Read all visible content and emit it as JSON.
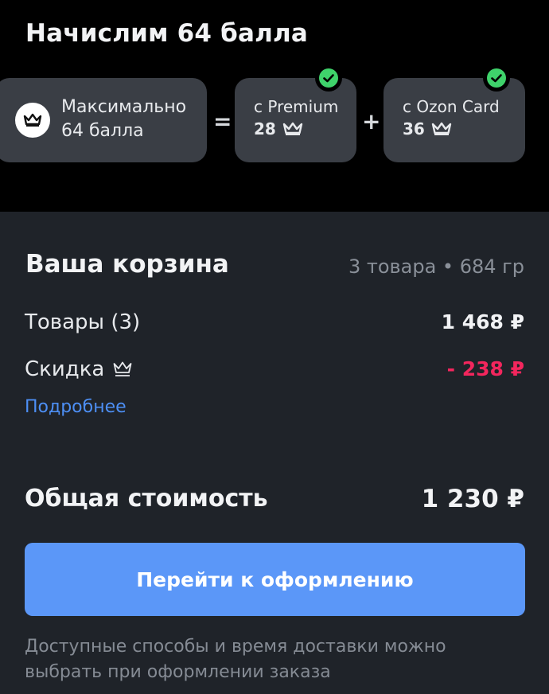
{
  "points": {
    "title": "Начислим 64 балла",
    "max": {
      "line1": "Максимально",
      "line2": "64 балла"
    },
    "premium": {
      "label": "с Premium",
      "value": "28",
      "checked": true
    },
    "ozon_card": {
      "label": "с Ozon Card",
      "value": "36",
      "checked": true
    },
    "op_equals": "=",
    "op_plus": "+"
  },
  "cart": {
    "title": "Ваша корзина",
    "meta": "3 товара • 684 гр",
    "goods_label": "Товары (3)",
    "goods_value": "1 468 ₽",
    "discount_label": "Скидка",
    "discount_value": "- 238 ₽",
    "more_link": "Подробнее",
    "total_label": "Общая стоимость",
    "total_value": "1 230 ₽",
    "checkout_button": "Перейти к оформлению",
    "footnote": "Доступные способы и время доставки можно выбрать при оформлении заказа"
  },
  "colors": {
    "accent_button": "#5b97f8",
    "discount": "#f3265d",
    "link": "#4d8ff5",
    "check": "#3fd36b"
  },
  "icons": {
    "crown": "crown-icon",
    "check": "check-circle-icon"
  }
}
